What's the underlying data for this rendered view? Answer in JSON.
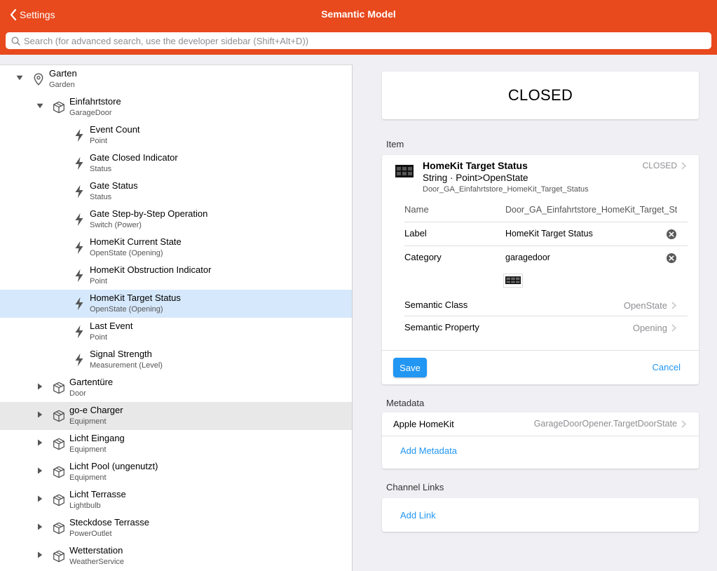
{
  "header": {
    "back_label": "Settings",
    "title": "Semantic Model",
    "search_placeholder": "Search (for advanced search, use the developer sidebar (Shift+Alt+D))"
  },
  "tree": [
    {
      "title": "Garten",
      "subtitle": "Garden",
      "icon": "location-pin-icon",
      "level": 0,
      "toggle": "expanded"
    },
    {
      "title": "Einfahrtstore",
      "subtitle": "GarageDoor",
      "icon": "equipment-cube-icon",
      "level": 1,
      "toggle": "expanded"
    },
    {
      "title": "Event Count",
      "subtitle": "Point",
      "icon": "lightning-bolt-icon",
      "level": 2,
      "toggle": "none"
    },
    {
      "title": "Gate Closed Indicator",
      "subtitle": "Status",
      "icon": "lightning-bolt-icon",
      "level": 2,
      "toggle": "none"
    },
    {
      "title": "Gate Status",
      "subtitle": "Status",
      "icon": "lightning-bolt-icon",
      "level": 2,
      "toggle": "none"
    },
    {
      "title": "Gate Step-by-Step Operation",
      "subtitle": "Switch (Power)",
      "icon": "lightning-bolt-icon",
      "level": 2,
      "toggle": "none"
    },
    {
      "title": "HomeKit Current State",
      "subtitle": "OpenState (Opening)",
      "icon": "lightning-bolt-icon",
      "level": 2,
      "toggle": "none"
    },
    {
      "title": "HomeKit Obstruction Indicator",
      "subtitle": "Point",
      "icon": "lightning-bolt-icon",
      "level": 2,
      "toggle": "none"
    },
    {
      "title": "HomeKit Target Status",
      "subtitle": "OpenState (Opening)",
      "icon": "lightning-bolt-icon",
      "level": 2,
      "toggle": "none",
      "selected": true
    },
    {
      "title": "Last Event",
      "subtitle": "Point",
      "icon": "lightning-bolt-icon",
      "level": 2,
      "toggle": "none"
    },
    {
      "title": "Signal Strength",
      "subtitle": "Measurement (Level)",
      "icon": "lightning-bolt-icon",
      "level": 2,
      "toggle": "none"
    },
    {
      "title": "Gartentüre",
      "subtitle": "Door",
      "icon": "equipment-cube-icon",
      "level": 1,
      "toggle": "collapsed"
    },
    {
      "title": "go-e Charger",
      "subtitle": "Equipment",
      "icon": "equipment-cube-icon",
      "level": 1,
      "toggle": "collapsed",
      "hovered": true
    },
    {
      "title": "Licht Eingang",
      "subtitle": "Equipment",
      "icon": "equipment-cube-icon",
      "level": 1,
      "toggle": "collapsed"
    },
    {
      "title": "Licht Pool (ungenutzt)",
      "subtitle": "Equipment",
      "icon": "equipment-cube-icon",
      "level": 1,
      "toggle": "collapsed"
    },
    {
      "title": "Licht Terrasse",
      "subtitle": "Lightbulb",
      "icon": "equipment-cube-icon",
      "level": 1,
      "toggle": "collapsed"
    },
    {
      "title": "Steckdose Terrasse",
      "subtitle": "PowerOutlet",
      "icon": "equipment-cube-icon",
      "level": 1,
      "toggle": "collapsed"
    },
    {
      "title": "Wetterstation",
      "subtitle": "WeatherService",
      "icon": "equipment-cube-icon",
      "level": 1,
      "toggle": "collapsed"
    }
  ],
  "state_display": "CLOSED",
  "item_section": {
    "title": "Item",
    "name": "HomeKit Target Status",
    "type": "String · Point>OpenState",
    "id": "Door_GA_Einfahrtstore_HomeKit_Target_Status",
    "state": "CLOSED",
    "fields": {
      "name_label": "Name",
      "name_value": "Door_GA_Einfahrtstore_HomeKit_Target_St",
      "label_label": "Label",
      "label_value": "HomeKit Target Status",
      "category_label": "Category",
      "category_value": "garagedoor",
      "semantic_class_label": "Semantic Class",
      "semantic_class_value": "OpenState",
      "semantic_property_label": "Semantic Property",
      "semantic_property_value": "Opening"
    },
    "save_label": "Save",
    "cancel_label": "Cancel"
  },
  "metadata_section": {
    "title": "Metadata",
    "name": "Apple HomeKit",
    "value": "GarageDoorOpener.TargetDoorState",
    "add_label": "Add Metadata"
  },
  "channel_links_section": {
    "title": "Channel Links",
    "add_label": "Add Link"
  },
  "colors": {
    "accent": "#e8491d",
    "link": "#2196f3",
    "selected_row": "#d6e8fb"
  }
}
